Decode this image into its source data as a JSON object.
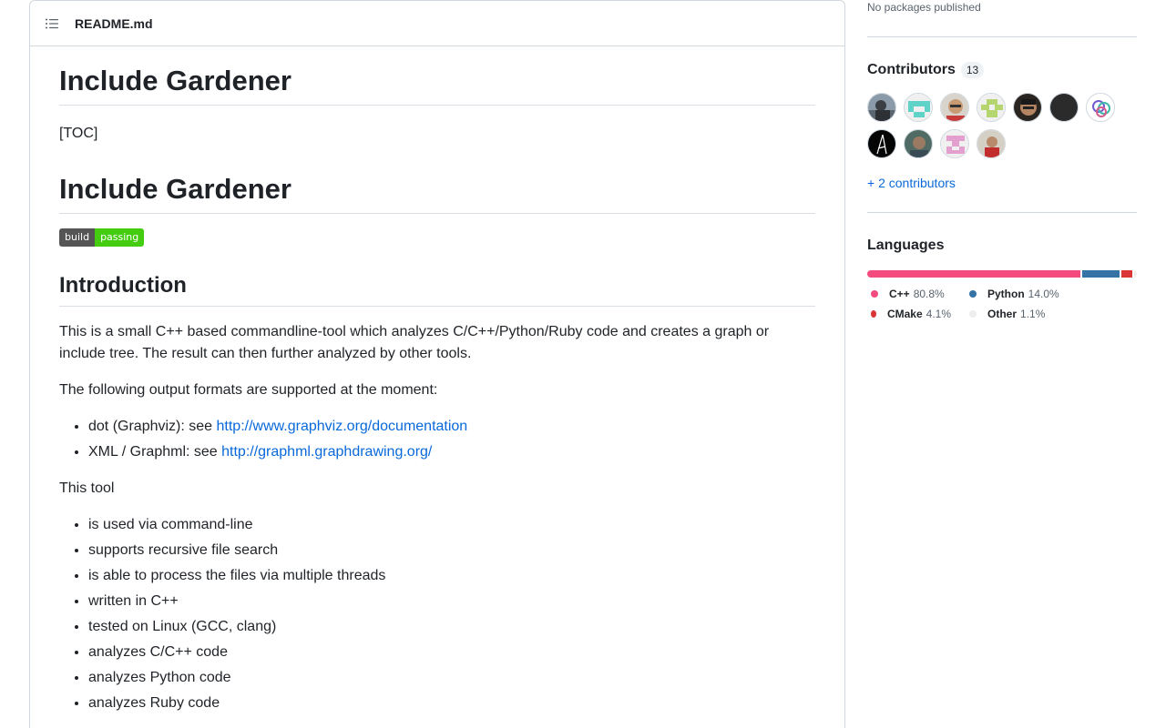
{
  "readme": {
    "filename": "README.md",
    "title1": "Include Gardener",
    "toc": "[TOC]",
    "title2": "Include Gardener",
    "badge": {
      "left": "build",
      "right": "passing"
    },
    "intro_heading": "Introduction",
    "intro_paragraph": "This is a small C++ based commandline-tool which analyzes C/C++/Python/Ruby code and creates a graph or include tree. The result can then further analyzed by other tools.",
    "formats_paragraph": "The following output formats are supported at the moment:",
    "formats": [
      {
        "prefix": "dot (Graphviz): see ",
        "link": "http://www.graphviz.org/documentation"
      },
      {
        "prefix": "XML / Graphml: see ",
        "link": "http://graphml.graphdrawing.org/"
      }
    ],
    "tool_paragraph": "This tool",
    "features": [
      "is used via command-line",
      "supports recursive file search",
      "is able to process the files via multiple threads",
      "written in C++",
      "tested on Linux (GCC, clang)",
      "analyzes C/C++ code",
      "analyzes Python code",
      "analyzes Ruby code"
    ]
  },
  "sidebar": {
    "packages_text": "No packages published",
    "contributors_title": "Contributors",
    "contributors_count": "13",
    "more_contributors": "+ 2 contributors",
    "languages_title": "Languages",
    "languages": [
      {
        "name": "C++",
        "percent": "80.8%",
        "color": "#f34b7d"
      },
      {
        "name": "Python",
        "percent": "14.0%",
        "color": "#3572a5"
      },
      {
        "name": "CMake",
        "percent": "4.1%",
        "color": "#da3434"
      },
      {
        "name": "Other",
        "percent": "1.1%",
        "color": "#ededed"
      }
    ]
  }
}
